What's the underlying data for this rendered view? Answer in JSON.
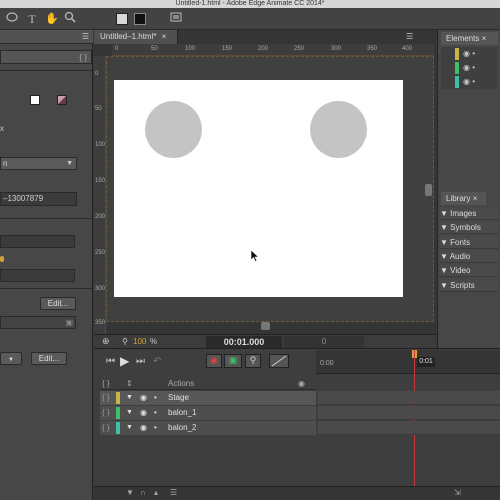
{
  "window": {
    "title": "Untitled-1.html - Adobe Edge Animate CC 2014*"
  },
  "toolbar": {
    "icons": [
      "ellipse-tool-icon",
      "text-tool-icon",
      "hand-tool-icon",
      "zoom-tool-icon",
      "fill-swatch",
      "stroke-swatch",
      "stage-toggle-icon"
    ],
    "text_tool": "T"
  },
  "left_panel": {
    "code_btn": "{ }",
    "dropdown_value": "n",
    "id_value": "–13007879",
    "x_label": "x",
    "edit_label": "Edit...",
    "edit2_label": "Edit..."
  },
  "document": {
    "tab_label": "Untitled–1.html*",
    "close": "×",
    "ruler_h": [
      "0",
      "50",
      "100",
      "150",
      "200",
      "250",
      "300",
      "350",
      "400"
    ],
    "ruler_v": [
      "0",
      "50",
      "100",
      "150",
      "200",
      "250",
      "300",
      "350"
    ],
    "zoom": "100",
    "zoom_unit": "%",
    "time": "00:01.000",
    "time_field": "0"
  },
  "elements_panel": {
    "title": "Elements",
    "close": "×"
  },
  "library_panel": {
    "title": "Library",
    "close": "×",
    "items": [
      "Images",
      "Symbols",
      "Fonts",
      "Audio",
      "Video",
      "Scripts"
    ]
  },
  "timeline": {
    "header": "Actions",
    "time_start": "0:00",
    "time_marker": "0:01",
    "rows": [
      {
        "name": "Stage",
        "color": "#c8b44a"
      },
      {
        "name": "balon_1",
        "color": "#3fbf6a"
      },
      {
        "name": "balon_2",
        "color": "#3fbfa3"
      }
    ]
  },
  "colors": {
    "stage": "#ffffff",
    "circle": "#c4c4c4",
    "accent_orange": "#d6a03a",
    "playhead": "#c43a3a"
  }
}
